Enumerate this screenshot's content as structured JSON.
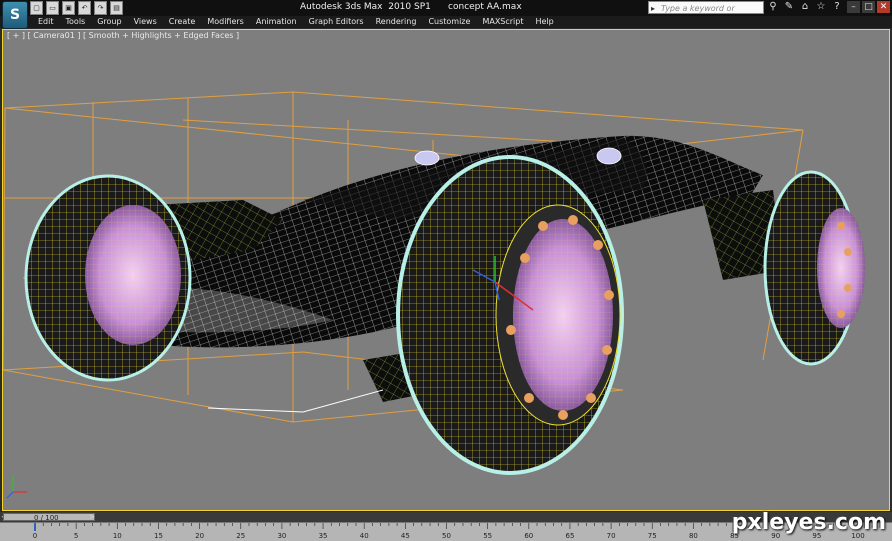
{
  "app": {
    "logo": "S",
    "title": "Autodesk 3ds Max  2010 SP1",
    "document": "concept AA.max"
  },
  "search": {
    "placeholder": "Type a keyword or phrase"
  },
  "menu": [
    "Edit",
    "Tools",
    "Group",
    "Views",
    "Create",
    "Modifiers",
    "Animation",
    "Graph Editors",
    "Rendering",
    "Customize",
    "MAXScript",
    "Help"
  ],
  "viewport": {
    "label": "[ + ] [ Camera01 ] [ Smooth + Highlights + Edged Faces ]",
    "active_border_color": "#f2d42a",
    "background_color": "#7e7e7e"
  },
  "time_slider": {
    "label": "0 / 100",
    "current_frame": 0,
    "total_frames": 100
  },
  "trackbar": {
    "ticks": [
      "0",
      "5",
      "10",
      "15",
      "20",
      "25",
      "30",
      "35",
      "40",
      "45",
      "50",
      "55",
      "60",
      "65",
      "70",
      "75",
      "80",
      "85",
      "90",
      "95",
      "100"
    ]
  },
  "watermark": "pxleyes.com",
  "icons": {
    "quick_access": [
      "new-icon",
      "open-icon",
      "save-icon",
      "undo-icon",
      "redo-icon",
      "project-folder-icon"
    ],
    "title_tools": [
      "binoculars-icon",
      "tools-icon",
      "communication-center-icon",
      "favorites-icon",
      "help-icon"
    ]
  },
  "colors": {
    "selection_wire": "#f0e030",
    "body_wire": "#ffffff",
    "bounding_box": "#e0a040",
    "rim": "#d8a0e0",
    "tire_highlight": "#b8f0e8",
    "bolts": "#e8a060"
  }
}
